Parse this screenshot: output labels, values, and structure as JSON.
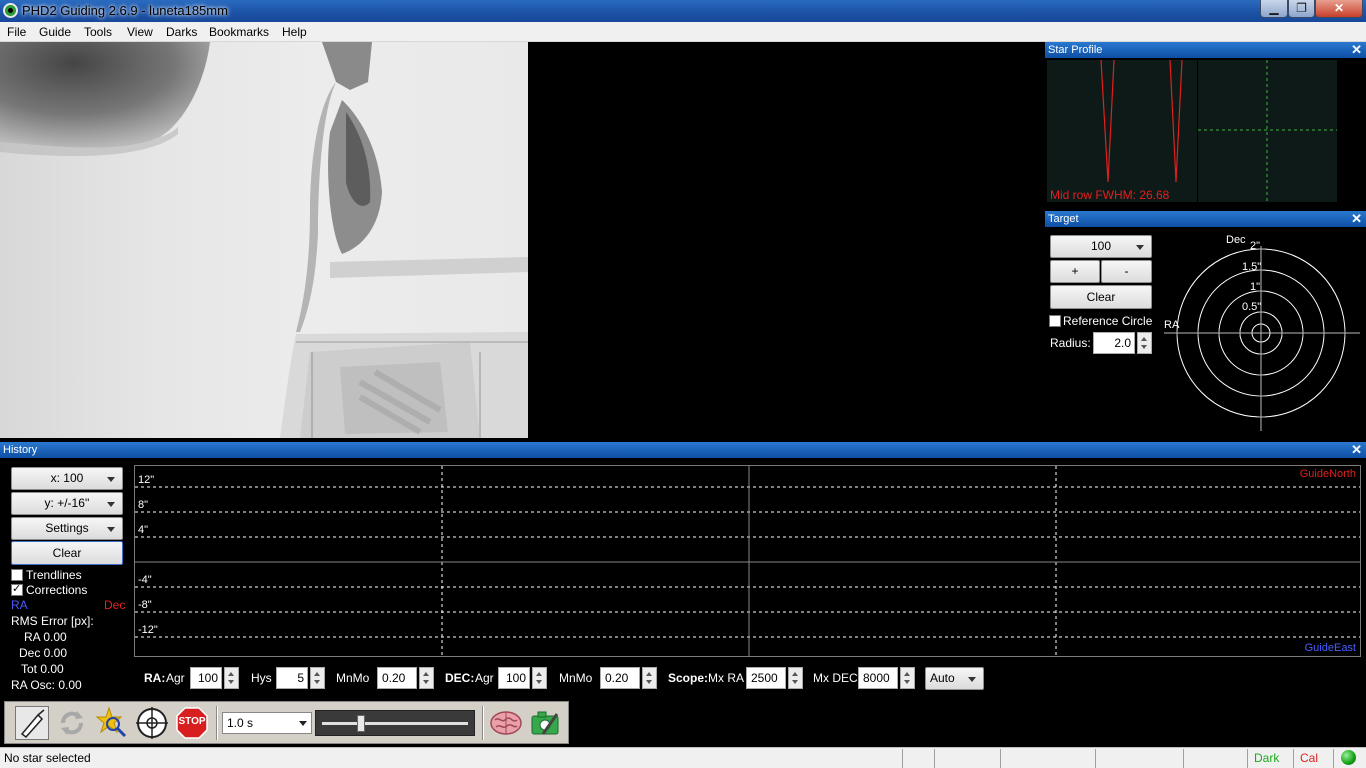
{
  "window": {
    "title": "PHD2 Guiding 2.6.9 - luneta185mm",
    "min_label": "▁",
    "max_label": "❐",
    "close_label": "✕"
  },
  "menu": [
    "File",
    "Guide",
    "Tools",
    "View",
    "Darks",
    "Bookmarks",
    "Help"
  ],
  "star_profile": {
    "title": "Star Profile",
    "fwhm_text": "Mid row FWHM: 26.68"
  },
  "target": {
    "title": "Target",
    "zoom_value": "100",
    "plus_label": "+",
    "minus_label": "-",
    "clear_label": "Clear",
    "reference_circle_label": "Reference Circle",
    "radius_label": "Radius:",
    "radius_value": "2.0",
    "axis_dec": "Dec",
    "axis_ra": "RA",
    "ring_labels": [
      "2\"",
      "1.5\"",
      "1\"",
      "0.5\""
    ]
  },
  "history": {
    "title": "History",
    "x_dropdown": "x: 100",
    "y_dropdown": "y: +/-16''",
    "settings_dropdown": "Settings",
    "clear_label": "Clear",
    "trendlines_label": "Trendlines",
    "corrections_label": "Corrections",
    "legend_ra": "RA",
    "legend_dec": "Dec",
    "rms_title": "RMS Error [px]:",
    "rms_ra": "RA 0.00",
    "rms_dec": "Dec 0.00",
    "rms_tot": "Tot 0.00",
    "ra_osc": "RA Osc: 0.00",
    "y_labels": [
      "12\"",
      "8\"",
      "4\"",
      "-4\"",
      "-8\"",
      "-12\""
    ],
    "guide_north": "GuideNorth",
    "guide_east": "GuideEast"
  },
  "params": {
    "ra_label": "RA:",
    "agr_label": "Agr",
    "ra_agr": "100",
    "hys_label": "Hys",
    "ra_hys": "5",
    "mnmo_label": "MnMo",
    "ra_mnmo": "0.20",
    "dec_label": "DEC:",
    "dec_agr_label": "Agr",
    "dec_agr": "100",
    "dec_mnmo_label": "MnMo",
    "dec_mnmo": "0.20",
    "scope_label": "Scope:",
    "mxra_label": "Mx RA",
    "mxra": "2500",
    "mxdec_label": "Mx DEC",
    "mxdec": "8000",
    "mode": "Auto"
  },
  "toolbar": {
    "exposure": "1.0 s",
    "stop_label": "STOP",
    "gamma_level": 0.27
  },
  "status": {
    "message": "No star selected",
    "dark_label": "Dark",
    "cal_label": "Cal"
  },
  "colors": {
    "accent": "#0d4fa4",
    "dec_red": "#e02020",
    "ra_blue": "#4a5cff",
    "green": "#1ea81e"
  }
}
